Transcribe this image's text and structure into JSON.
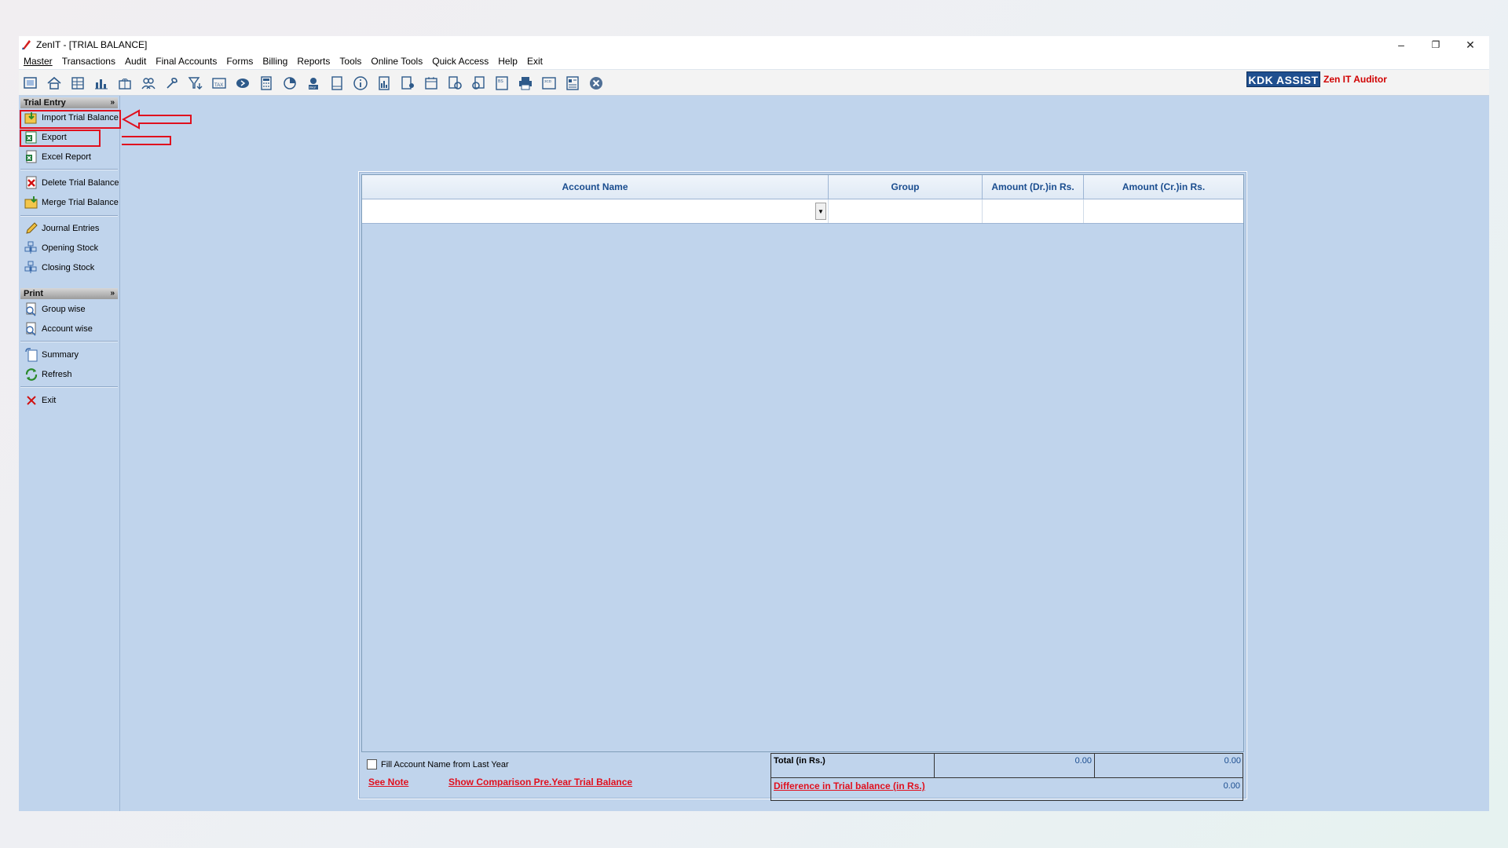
{
  "window": {
    "title": "ZenIT - [TRIAL BALANCE]",
    "controls": [
      "–",
      "❐",
      "✕"
    ]
  },
  "menubar": [
    {
      "u": "M",
      "rest": "aster"
    },
    {
      "pre": "",
      "u": "T",
      "rest": "ransactions"
    },
    {
      "u": "A",
      "rest": "udit"
    },
    {
      "pre": "Final ",
      "u": "A",
      "rest": "ccounts"
    },
    {
      "u": "F",
      "rest": "orms",
      "mid": "o"
    },
    {
      "u": "B",
      "rest": "illing"
    },
    {
      "u": "R",
      "rest": "eports"
    },
    {
      "u": "T",
      "rest": "ools"
    },
    {
      "u": "O",
      "rest": "nline Tools"
    },
    {
      "u": "Q",
      "rest": "uick Access"
    },
    {
      "u": "H",
      "rest": "elp"
    },
    {
      "u": "E",
      "rest": "xit"
    }
  ],
  "menu_labels": [
    "Master",
    "Transactions",
    "Audit",
    "Final Accounts",
    "Forms",
    "Billing",
    "Reports",
    "Tools",
    "Online Tools",
    "Quick Access",
    "Help",
    "Exit"
  ],
  "toolbar": {
    "icons": [
      "company-icon",
      "home-icon",
      "ledger-icon",
      "chart-icon",
      "gift-icon",
      "users-icon",
      "wrench-icon",
      "filter-icon",
      "tax-icon",
      "voucher-icon",
      "calculator-icon",
      "pie-icon",
      "pay-icon",
      "book-icon",
      "info-icon",
      "report-icon",
      "doc-user-icon",
      "calendar-icon",
      "gear-doc-icon",
      "refresh-doc-icon",
      "bs-icon",
      "printer-icon",
      "tds-icon",
      "form-icon",
      "close-circle-icon"
    ],
    "kdk_label": "KDK ASSIST",
    "auditor_label": "Zen IT Auditor"
  },
  "sidebar": {
    "section1": "Trial Entry",
    "section2": "Print",
    "items": [
      {
        "label": "Import Trial Balance",
        "icon": "import-icon"
      },
      {
        "label": "Export",
        "icon": "excel-icon"
      },
      {
        "label": "Excel Report",
        "icon": "excel-report-icon"
      },
      {
        "label": "Delete Trial Balance",
        "icon": "delete-icon"
      },
      {
        "label": "Merge Trial Balance",
        "icon": "merge-icon"
      },
      {
        "label": "Journal Entries",
        "icon": "pencil-icon"
      },
      {
        "label": "Opening Stock",
        "icon": "stock-icon"
      },
      {
        "label": "Closing Stock",
        "icon": "stock-icon"
      },
      {
        "label": "Group wise",
        "icon": "print-group-icon"
      },
      {
        "label": "Account wise",
        "icon": "print-account-icon"
      },
      {
        "label": "Summary",
        "icon": "summary-icon"
      },
      {
        "label": "Refresh",
        "icon": "refresh-icon"
      },
      {
        "label": "Exit",
        "icon": "exit-icon"
      }
    ]
  },
  "grid": {
    "columns": [
      "Account Name",
      "Group",
      "Amount (Dr.)in Rs.",
      "Amount (Cr.)in Rs."
    ]
  },
  "footer": {
    "checkbox_label": "Fill Account Name from Last Year",
    "see_note": "See Note",
    "comparison_link": "Show Comparison Pre.Year Trial Balance",
    "total_label": "Total (in Rs.)",
    "total_dr": "0.00",
    "total_cr": "0.00",
    "difference_label": "Difference in Trial balance (in Rs.)",
    "difference_value": "0.00"
  },
  "colors": {
    "workspace": "#c0d4ec",
    "header_text": "#1a4d8f",
    "highlight": "#e0101e",
    "kdk": "#1f4f8f"
  }
}
